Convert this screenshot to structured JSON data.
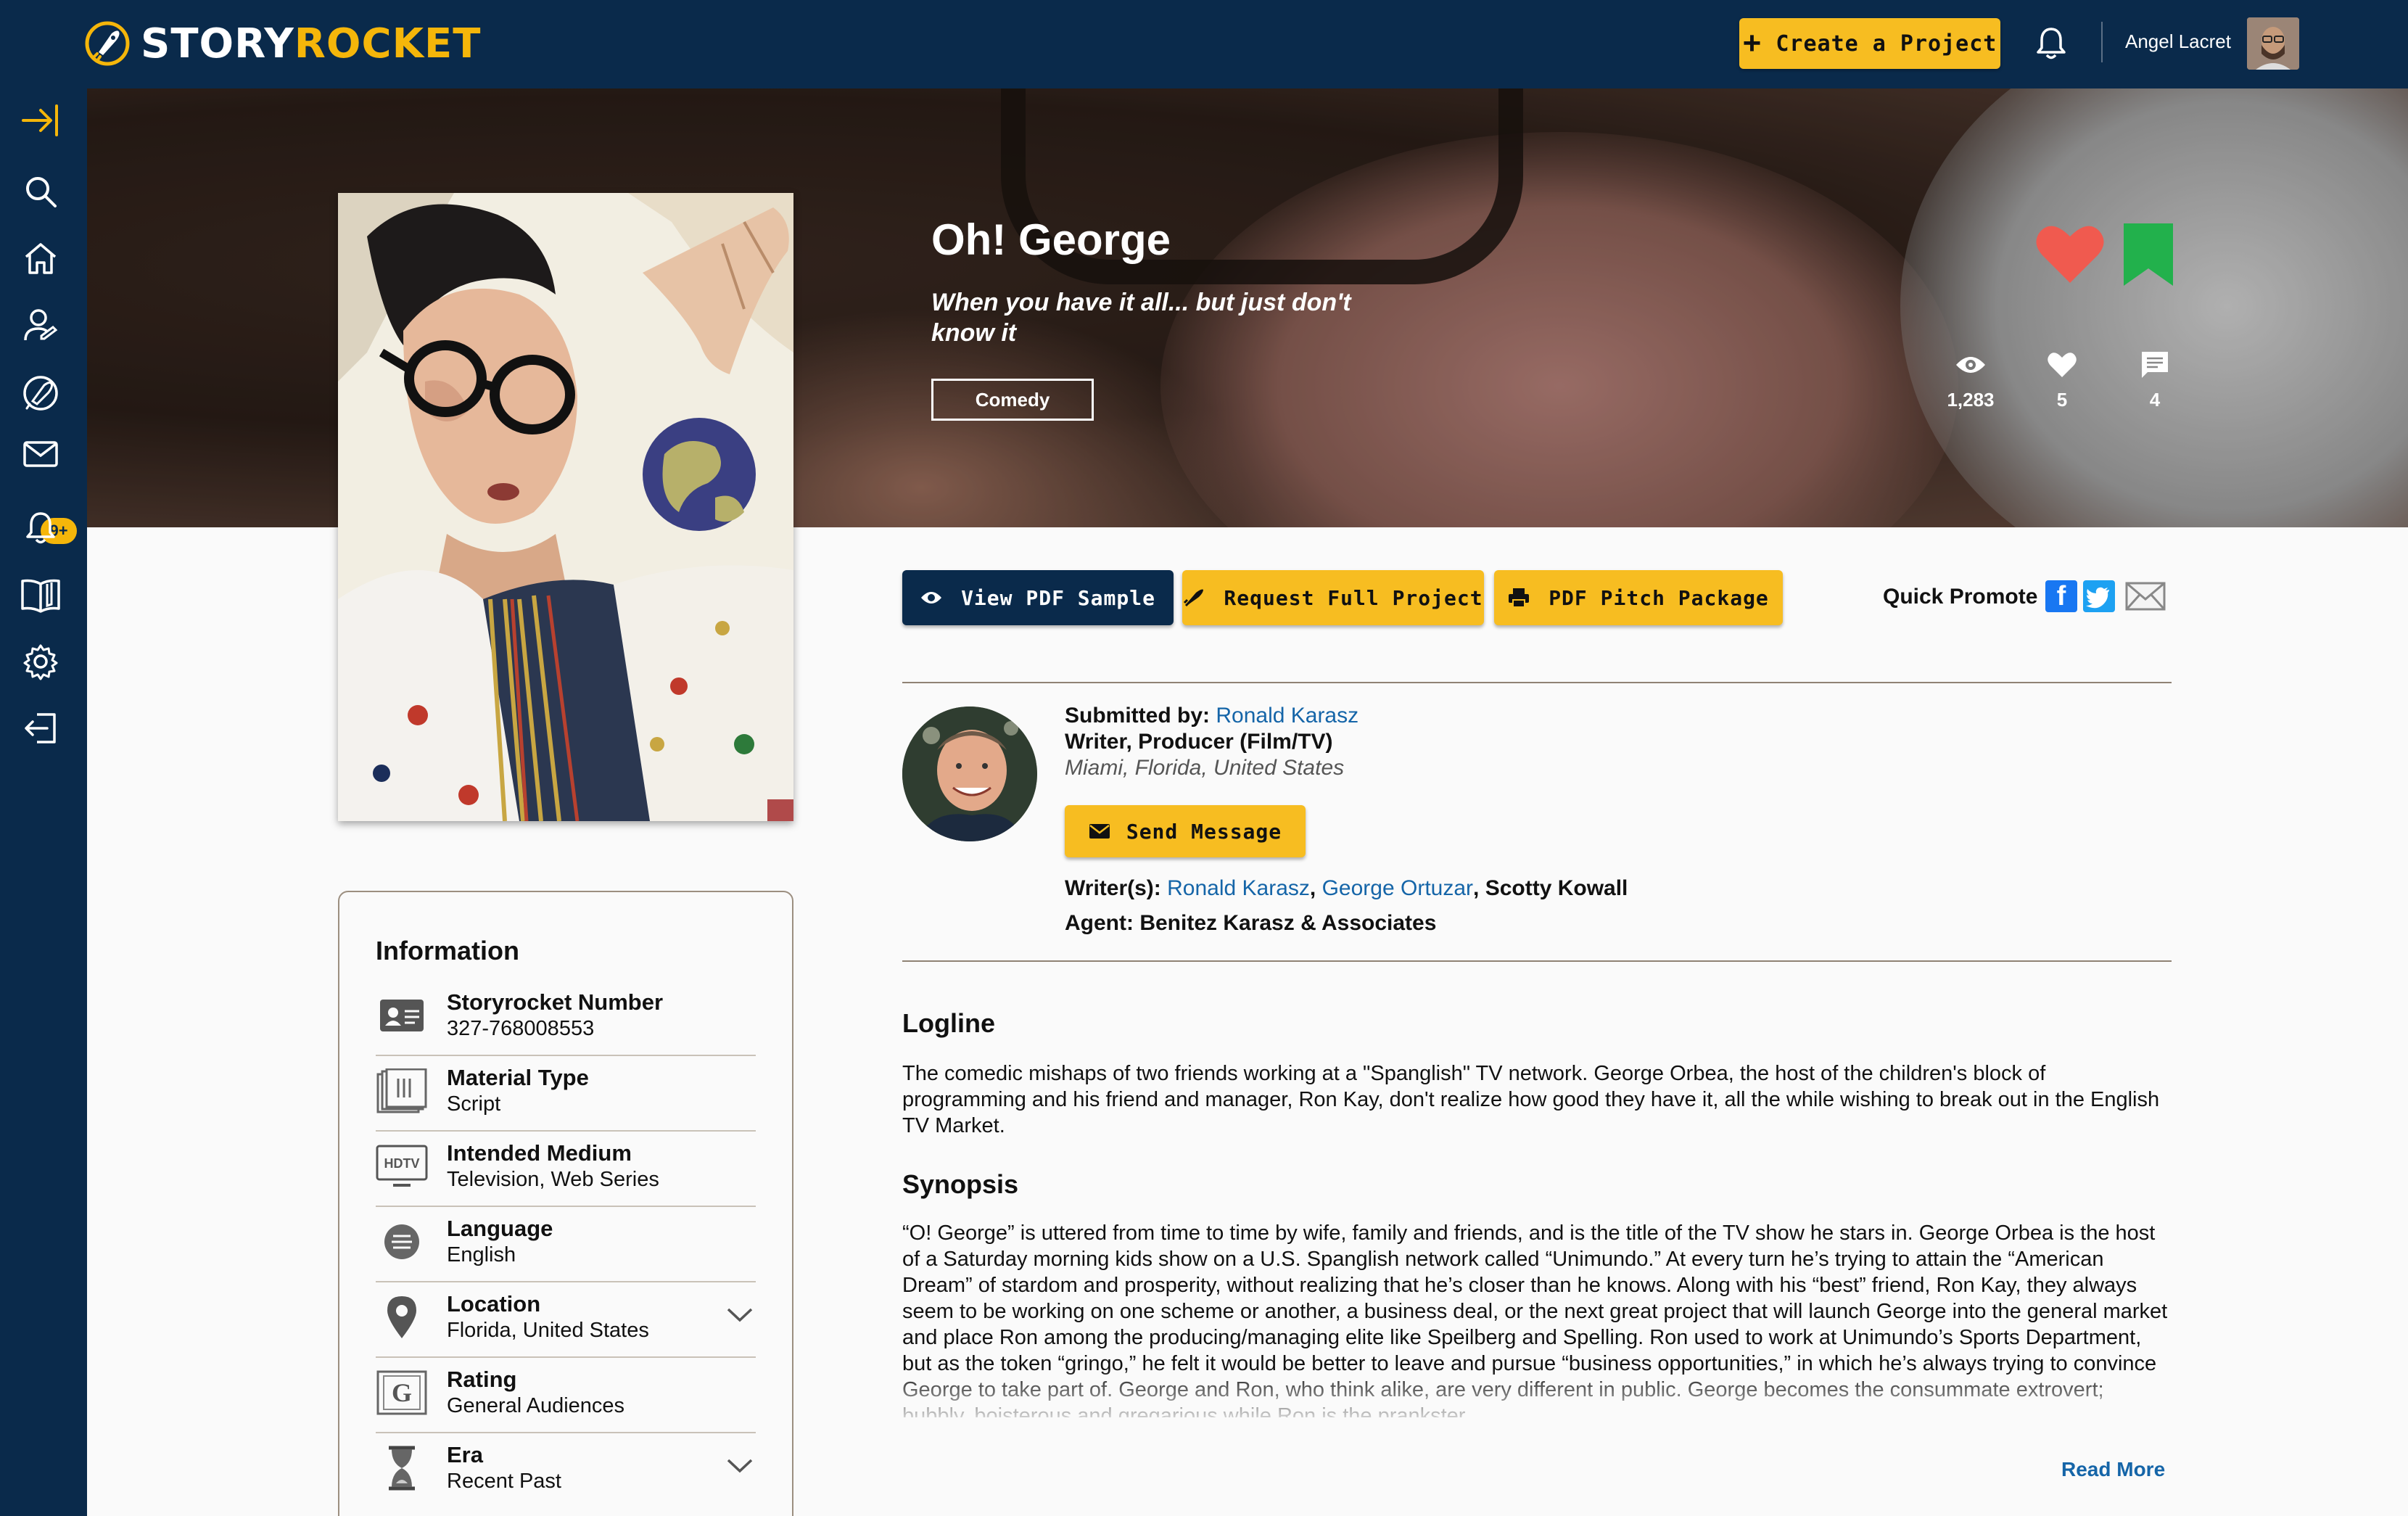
{
  "brand": {
    "name_white": "STORY",
    "name_yellow": "ROCKET"
  },
  "header": {
    "create_label": "Create a Project",
    "user_name": "Angel Lacret"
  },
  "sidebar": {
    "items": [
      {
        "icon": "collapse-arrow-icon"
      },
      {
        "icon": "search-icon"
      },
      {
        "icon": "home-icon"
      },
      {
        "icon": "user-icon"
      },
      {
        "icon": "rocket-icon"
      },
      {
        "icon": "mail-icon"
      },
      {
        "icon": "bell-icon"
      },
      {
        "icon": "book-icon"
      },
      {
        "icon": "gear-icon"
      },
      {
        "icon": "logout-icon"
      }
    ],
    "mail_badge": "9+"
  },
  "project": {
    "title": "Oh! George",
    "tagline": "When you have it all... but just don't know it",
    "genre": "Comedy",
    "stats": {
      "views": "1,283",
      "likes": "5",
      "comments": "4"
    }
  },
  "actions": {
    "view_pdf": "View PDF Sample",
    "request_full": "Request Full Project",
    "pitch_package": "PDF Pitch Package",
    "quick_promote": "Quick Promote"
  },
  "submitter": {
    "submitted_by_label": "Submitted by:",
    "name": "Ronald Karasz",
    "role": "Writer, Producer (Film/TV)",
    "location": "Miami, Florida, United States",
    "send_message": "Send Message",
    "writers_label": "Writer(s):",
    "writer1": "Ronald Karasz",
    "writer2": "George Ortuzar",
    "writer3": "Scotty Kowall",
    "agent_label": "Agent:",
    "agent": "Benitez Karasz & Associates"
  },
  "logline": {
    "heading": "Logline",
    "text": "The comedic mishaps of two friends working at a \"Spanglish\" TV network. George Orbea, the host of the children's block of programming and his friend and manager, Ron Kay, don't realize how good they have it, all the while wishing to break out in the English TV Market."
  },
  "synopsis": {
    "heading": "Synopsis",
    "text": "“O! George” is uttered from time to time by wife, family and friends, and is the title of the TV show he stars in. George Orbea is the host of a Saturday morning kids show on a U.S. Spanglish network called “Unimundo.” At every turn he’s trying to attain the “American Dream” of stardom and prosperity, without realizing that he’s closer than he knows. Along with his “best” friend, Ron Kay, they always seem to be working on one scheme or another, a business deal, or the next great project that will launch George into the general market and place Ron among the producing/managing elite like Speilberg and Spelling. Ron used to work at Unimundo’s Sports Department, but as the token “gringo,” he felt it would be better to leave and pursue “business opportunities,” in which he’s always trying to convince George to take part of. George and Ron, who think alike, are very different in public. George becomes the consummate extrovert; bubbly, boisterous and gregarious while Ron is the prankster",
    "read_more": "Read More"
  },
  "info": {
    "heading": "Information",
    "rows": [
      {
        "label": "Storyrocket Number",
        "value": "327-768008553",
        "icon": "id-card-icon"
      },
      {
        "label": "Material Type",
        "value": "Script",
        "icon": "script-icon"
      },
      {
        "label": "Intended Medium",
        "value": "Television, Web Series",
        "icon": "hdtv-icon",
        "icon_text": "HDTV"
      },
      {
        "label": "Language",
        "value": "English",
        "icon": "language-icon"
      },
      {
        "label": "Location",
        "value": "Florida, United States",
        "icon": "location-pin-icon"
      },
      {
        "label": "Rating",
        "value": "General Audiences",
        "icon": "rating-icon",
        "icon_text": "G"
      },
      {
        "label": "Era",
        "value": "Recent Past",
        "icon": "hourglass-icon"
      }
    ]
  },
  "colors": {
    "navy": "#0a2a4b",
    "yellow": "#f7bd21",
    "link": "#1565a8",
    "heart": "#f05a4f",
    "bookmark": "#22b14c"
  }
}
